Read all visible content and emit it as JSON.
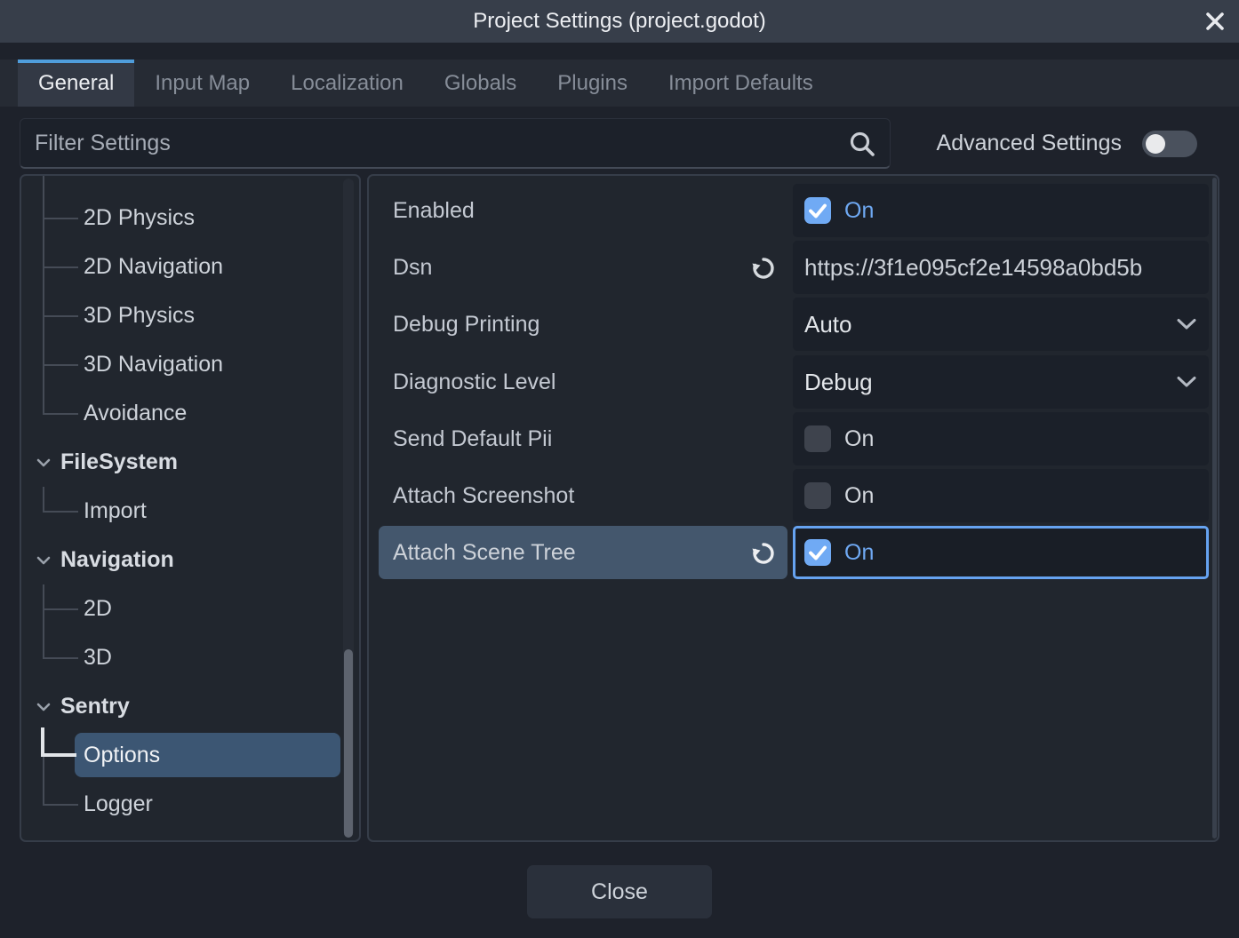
{
  "window": {
    "title": "Project Settings (project.godot)"
  },
  "tabs": [
    {
      "label": "General",
      "active": true
    },
    {
      "label": "Input Map",
      "active": false
    },
    {
      "label": "Localization",
      "active": false
    },
    {
      "label": "Globals",
      "active": false
    },
    {
      "label": "Plugins",
      "active": false
    },
    {
      "label": "Import Defaults",
      "active": false
    }
  ],
  "filter": {
    "placeholder": "Filter Settings"
  },
  "advanced_settings": {
    "label": "Advanced Settings",
    "enabled": false
  },
  "sidebar": {
    "items": [
      {
        "label": "2D Physics",
        "type": "child"
      },
      {
        "label": "2D Navigation",
        "type": "child"
      },
      {
        "label": "3D Physics",
        "type": "child"
      },
      {
        "label": "3D Navigation",
        "type": "child"
      },
      {
        "label": "Avoidance",
        "type": "child"
      },
      {
        "label": "FileSystem",
        "type": "group",
        "expanded": true
      },
      {
        "label": "Import",
        "type": "child"
      },
      {
        "label": "Navigation",
        "type": "group",
        "expanded": true
      },
      {
        "label": "2D",
        "type": "child"
      },
      {
        "label": "3D",
        "type": "child"
      },
      {
        "label": "Sentry",
        "type": "group",
        "expanded": true
      },
      {
        "label": "Options",
        "type": "child",
        "selected": true
      },
      {
        "label": "Logger",
        "type": "child"
      }
    ]
  },
  "properties": {
    "rows": [
      {
        "label": "Enabled",
        "type": "checkbox",
        "checked": true,
        "value": "On"
      },
      {
        "label": "Dsn",
        "type": "text",
        "value": "https://3f1e095cf2e14598a0bd5b",
        "revert": true
      },
      {
        "label": "Debug Printing",
        "type": "dropdown",
        "value": "Auto"
      },
      {
        "label": "Diagnostic Level",
        "type": "dropdown",
        "value": "Debug"
      },
      {
        "label": "Send Default Pii",
        "type": "checkbox",
        "checked": false,
        "value": "On"
      },
      {
        "label": "Attach Screenshot",
        "type": "checkbox",
        "checked": false,
        "value": "On"
      },
      {
        "label": "Attach Scene Tree",
        "type": "checkbox",
        "checked": true,
        "value": "On",
        "revert": true,
        "highlighted": true,
        "focused": true
      }
    ]
  },
  "footer": {
    "close_label": "Close"
  },
  "colors": {
    "accent_blue": "#6fa9f3",
    "tab_accent": "#4f9ddb",
    "selection": "#3c5673",
    "row_highlight": "#44576d",
    "focus_border": "#66a3f1",
    "titlebar": "#373e4a",
    "panel": "#21262e",
    "background": "#1e222b"
  }
}
